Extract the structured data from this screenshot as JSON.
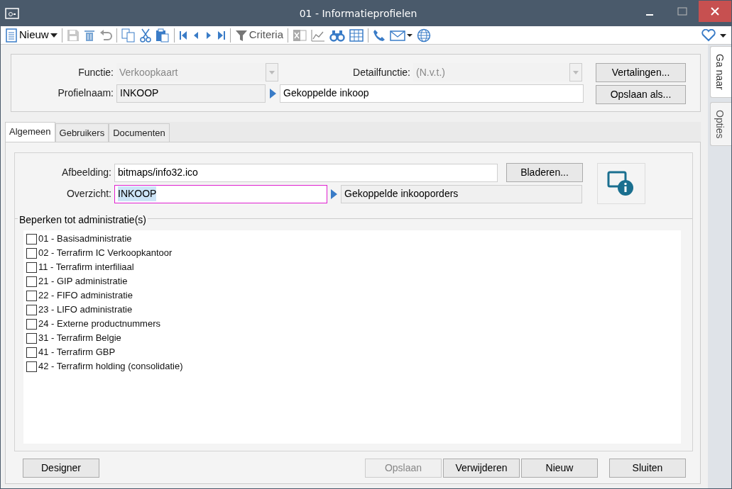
{
  "window": {
    "title": "01 - Informatieprofielen"
  },
  "toolbar": {
    "new_button": "Nieuw",
    "criteria_button": "Criteria"
  },
  "header": {
    "function": {
      "label": "Functie:",
      "value": "Verkoopkaart",
      "disabled": true
    },
    "detail_function": {
      "label": "Detailfunctie:",
      "value": "(N.v.t.)",
      "disabled": true
    },
    "profile_name": {
      "label": "Profielnaam:",
      "value": "INKOOP",
      "linked_value": "Gekoppelde inkoop"
    },
    "buttons": [
      "Vertalingen...",
      "Opslaan als..."
    ]
  },
  "tabs": [
    {
      "label": "Algemeen",
      "selected": true
    },
    {
      "label": "Gebruikers",
      "selected": false
    },
    {
      "label": "Documenten",
      "selected": false
    }
  ],
  "general": {
    "image": {
      "label": "Afbeelding:",
      "value": "bitmaps/info32.ico",
      "browse_button": "Bladeren..."
    },
    "overview": {
      "label": "Overzicht:",
      "value": "INKOOP",
      "focused": true,
      "linked_value": "Gekoppelde inkooporders"
    },
    "restrict_group": {
      "title": "Beperken tot administratie(s)",
      "items": [
        {
          "label": "01 - Basisadministratie",
          "checked": false
        },
        {
          "label": "02 - Terrafirm IC Verkoopkantoor",
          "checked": false
        },
        {
          "label": "11 - Terrafirm interfiliaal",
          "checked": false
        },
        {
          "label": "21 - GIP administratie",
          "checked": false
        },
        {
          "label": "22 - FIFO administratie",
          "checked": false
        },
        {
          "label": "23 - LIFO administratie",
          "checked": false
        },
        {
          "label": "24 - Externe productnummers",
          "checked": false
        },
        {
          "label": "31 - Terrafirm Belgie",
          "checked": false
        },
        {
          "label": "41 - Terrafirm GBP",
          "checked": false
        },
        {
          "label": "42 - Terrafirm holding (consolidatie)",
          "checked": false
        }
      ]
    }
  },
  "footer_buttons": [
    {
      "label": "Designer",
      "disabled": false
    },
    {
      "label": "Opslaan",
      "disabled": true
    },
    {
      "label": "Verwijderen",
      "disabled": false
    },
    {
      "label": "Nieuw",
      "disabled": false
    },
    {
      "label": "Sluiten",
      "disabled": false
    }
  ],
  "side_tabs": [
    {
      "label": "Ga naar",
      "selected": true
    },
    {
      "label": "Opties",
      "selected": false
    }
  ]
}
